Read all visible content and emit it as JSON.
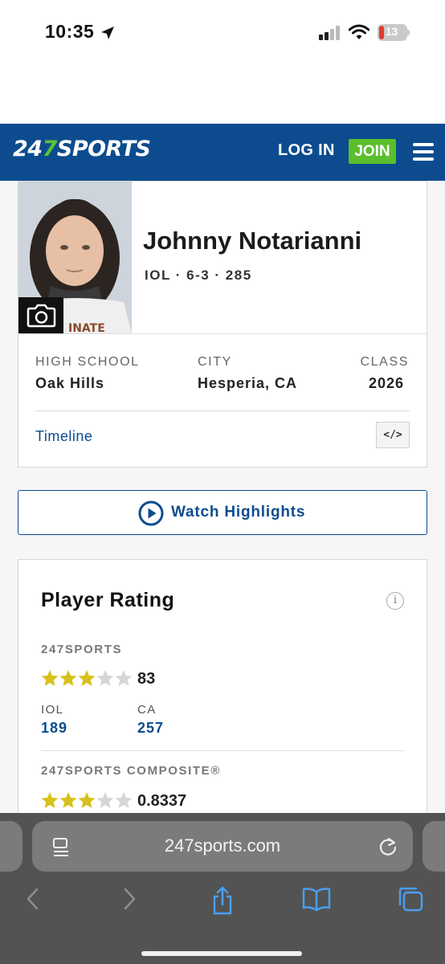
{
  "status_bar": {
    "time": "10:35",
    "battery_level": "13"
  },
  "header": {
    "logo_prefix": "24",
    "logo_seven": "7",
    "logo_suffix": "SPORTS",
    "login_label": "LOG IN",
    "join_label": "JOIN",
    "brand_color": "#0c4c8e",
    "accent_color": "#5bbe2d"
  },
  "player": {
    "name": "Johnny Notarianni",
    "meta": "IOL · 6-3 · 285",
    "info": [
      {
        "label": "HIGH SCHOOL",
        "value": "Oak Hills"
      },
      {
        "label": "CITY",
        "value": "Hesperia, CA"
      },
      {
        "label": "CLASS",
        "value": "2026"
      }
    ],
    "timeline_label": "Timeline",
    "embed_label": "</>"
  },
  "highlights": {
    "label": "Watch Highlights"
  },
  "rating": {
    "title": "Player Rating",
    "info_glyph": "i",
    "sports247": {
      "label": "247SPORTS",
      "stars": 3,
      "max_stars": 5,
      "value": "83",
      "ranks": [
        {
          "label": "IOL",
          "value": "189"
        },
        {
          "label": "CA",
          "value": "257"
        }
      ]
    },
    "composite": {
      "label": "247SPORTS COMPOSITE®",
      "stars": 3,
      "max_stars": 5,
      "value": "0.8337"
    }
  },
  "browser": {
    "url": "247sports.com",
    "icons": [
      "reader-icon",
      "reload-icon",
      "back-icon",
      "forward-icon",
      "share-icon",
      "bookmarks-icon",
      "tabs-icon"
    ]
  }
}
